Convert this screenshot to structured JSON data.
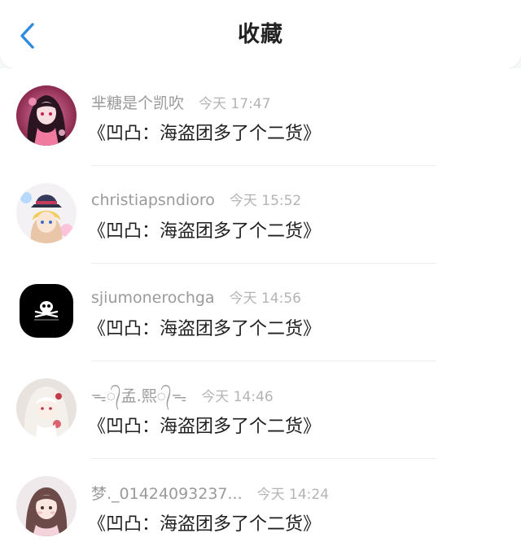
{
  "header": {
    "title": "收藏",
    "back_icon": "chevron-left-icon",
    "accent_color": "#2f8bdc"
  },
  "favorites": [
    {
      "username": "芈糖是个凯吹",
      "time": "今天 17:47",
      "title": "《凹凸：海盗团多了个二货》",
      "avatar": "anime-girl-avatar"
    },
    {
      "username": "christiapsndioro",
      "time": "今天 15:52",
      "title": "《凹凸：海盗团多了个二货》",
      "avatar": "anime-boy-hat-avatar"
    },
    {
      "username": "sjiumonerochga",
      "time": "今天 14:56",
      "title": "《凹凸：海盗团多了个二货》",
      "avatar": "skull-logo-avatar"
    },
    {
      "username": "ᯓ᭄孟.熙᭄ᯓ",
      "time": "今天 14:46",
      "title": "《凹凸：海盗团多了个二货》",
      "avatar": "white-hair-girl-avatar"
    },
    {
      "username": "梦._01424093237...",
      "time": "今天 14:24",
      "title": "《凹凸：海盗团多了个二货》",
      "avatar": "illustrated-girl-avatar"
    }
  ]
}
